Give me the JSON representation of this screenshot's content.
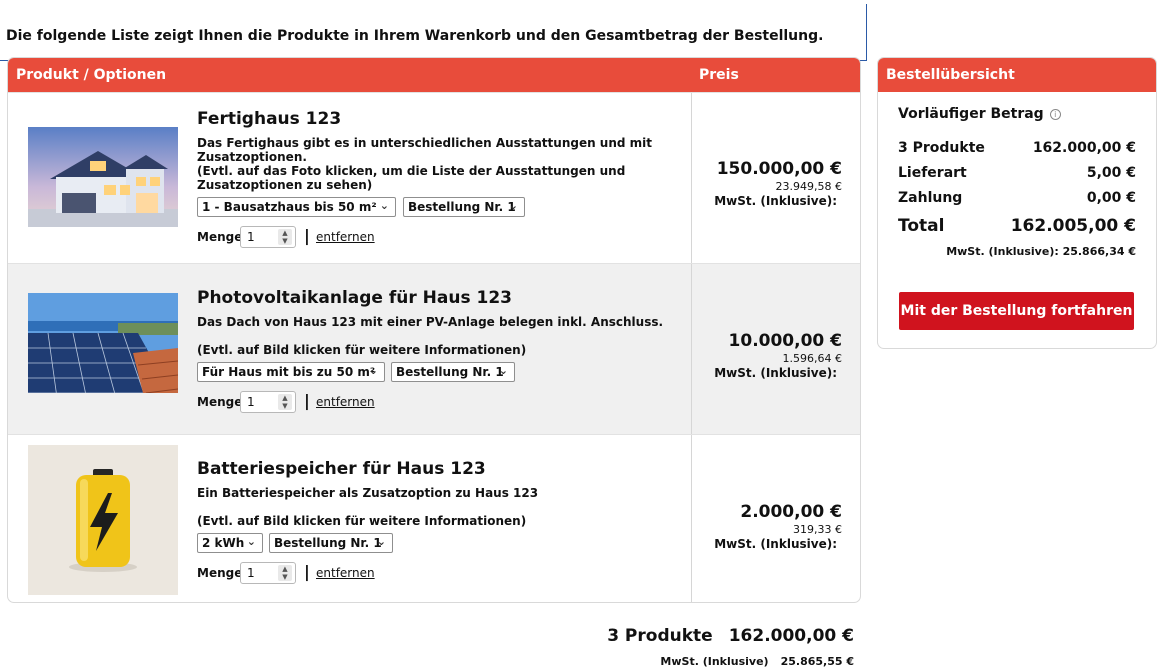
{
  "intro": "Die folgende Liste zeigt Ihnen die Produkte in Ihrem Warenkorb und den Gesamtbetrag der Bestellung.",
  "cart": {
    "header_product": "Produkt / Optionen",
    "header_price": "Preis",
    "qty_label": "Menge:",
    "remove_label": "entfernen",
    "items": [
      {
        "title": "Fertighaus 123",
        "description": "Das Fertighaus gibt es in unterschiedlichen Ausstattungen und mit Zusatzoptionen.",
        "note": "(Evtl. auf das Foto klicken, um die Liste der Ausstattungen und Zusatzoptionen zu sehen)",
        "option1": "1 - Bausatzhaus bis 50 m²",
        "option2": "Bestellung Nr. 1",
        "quantity": "1",
        "price": "150.000,00 €",
        "tax": "23.949,58 €",
        "mwst": "MwSt. (Inklusive):",
        "image": "house-photo"
      },
      {
        "title": "Photovoltaikanlage für Haus 123",
        "description": "Das Dach von Haus 123 mit einer PV-Anlage belegen inkl. Anschluss.",
        "note": "(Evtl. auf Bild klicken für weitere Informationen)",
        "option1": "Für Haus mit bis zu 50 m²",
        "option2": "Bestellung Nr. 1",
        "quantity": "1",
        "price": "10.000,00 €",
        "tax": "1.596,64 €",
        "mwst": "MwSt. (Inklusive):",
        "image": "solar-panel-photo"
      },
      {
        "title": "Batteriespeicher für Haus 123",
        "description": "Ein Batteriespeicher als Zusatzoption zu Haus 123",
        "note": "(Evtl. auf Bild klicken für weitere Informationen)",
        "option1": "2 kWh",
        "option2": "Bestellung Nr. 1",
        "quantity": "1",
        "price": "2.000,00 €",
        "tax": "319,33 €",
        "mwst": "MwSt. (Inklusive):",
        "image": "battery-photo"
      }
    ]
  },
  "summary": {
    "title": "Bestellübersicht",
    "provisional": "Vorläufiger Betrag",
    "products_label": "3 Produkte",
    "products_value": "162.000,00 €",
    "delivery_label": "Lieferart",
    "delivery_value": "5,00 €",
    "payment_label": "Zahlung",
    "payment_value": "0,00 €",
    "total_label": "Total",
    "total_value": "162.005,00 €",
    "mwst": "MwSt. (Inklusive): 25.866,34 €",
    "button": "Mit der Bestellung fortfahren"
  },
  "footer": {
    "count": "3 Produkte",
    "total": "162.000,00 €",
    "mwst_label": "MwSt. (Inklusive)",
    "mwst_value": "25.865,55 €"
  },
  "colors": {
    "accent": "#e84c3b",
    "button": "#d0131e",
    "intro_border": "#2b5aa7"
  }
}
